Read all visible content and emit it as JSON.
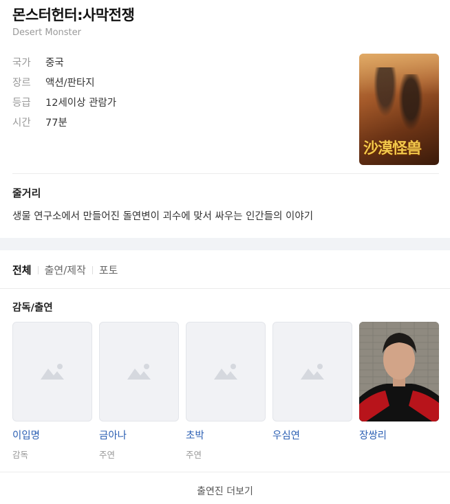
{
  "movie": {
    "title": "몬스터헌터:사막전쟁",
    "original_title": "Desert Monster",
    "info": [
      {
        "key": "국가",
        "value": "중국"
      },
      {
        "key": "장르",
        "value": "액션/판타지"
      },
      {
        "key": "등급",
        "value": "12세이상 관람가"
      },
      {
        "key": "시간",
        "value": "77분"
      }
    ],
    "poster_text": "沙漠怪兽"
  },
  "synopsis": {
    "heading": "줄거리",
    "text": "생물 연구소에서 만들어진 돌연변이 괴수에 맞서 싸우는 인간들의 이야기"
  },
  "tabs": [
    {
      "label": "전체",
      "active": true
    },
    {
      "label": "출연/제작",
      "active": false
    },
    {
      "label": "포토",
      "active": false
    }
  ],
  "cast_section": {
    "heading": "감독/출연",
    "people": [
      {
        "name": "이입명",
        "role": "감독"
      },
      {
        "name": "금아나",
        "role": "주연"
      },
      {
        "name": "초박",
        "role": "주연"
      },
      {
        "name": "우심연",
        "role": ""
      },
      {
        "name": "장쌍리",
        "role": ""
      }
    ]
  },
  "more_button": "출연진 더보기",
  "colors": {
    "link": "#2b5fb3",
    "muted": "#999999",
    "page_bg": "#f1f3f6"
  }
}
